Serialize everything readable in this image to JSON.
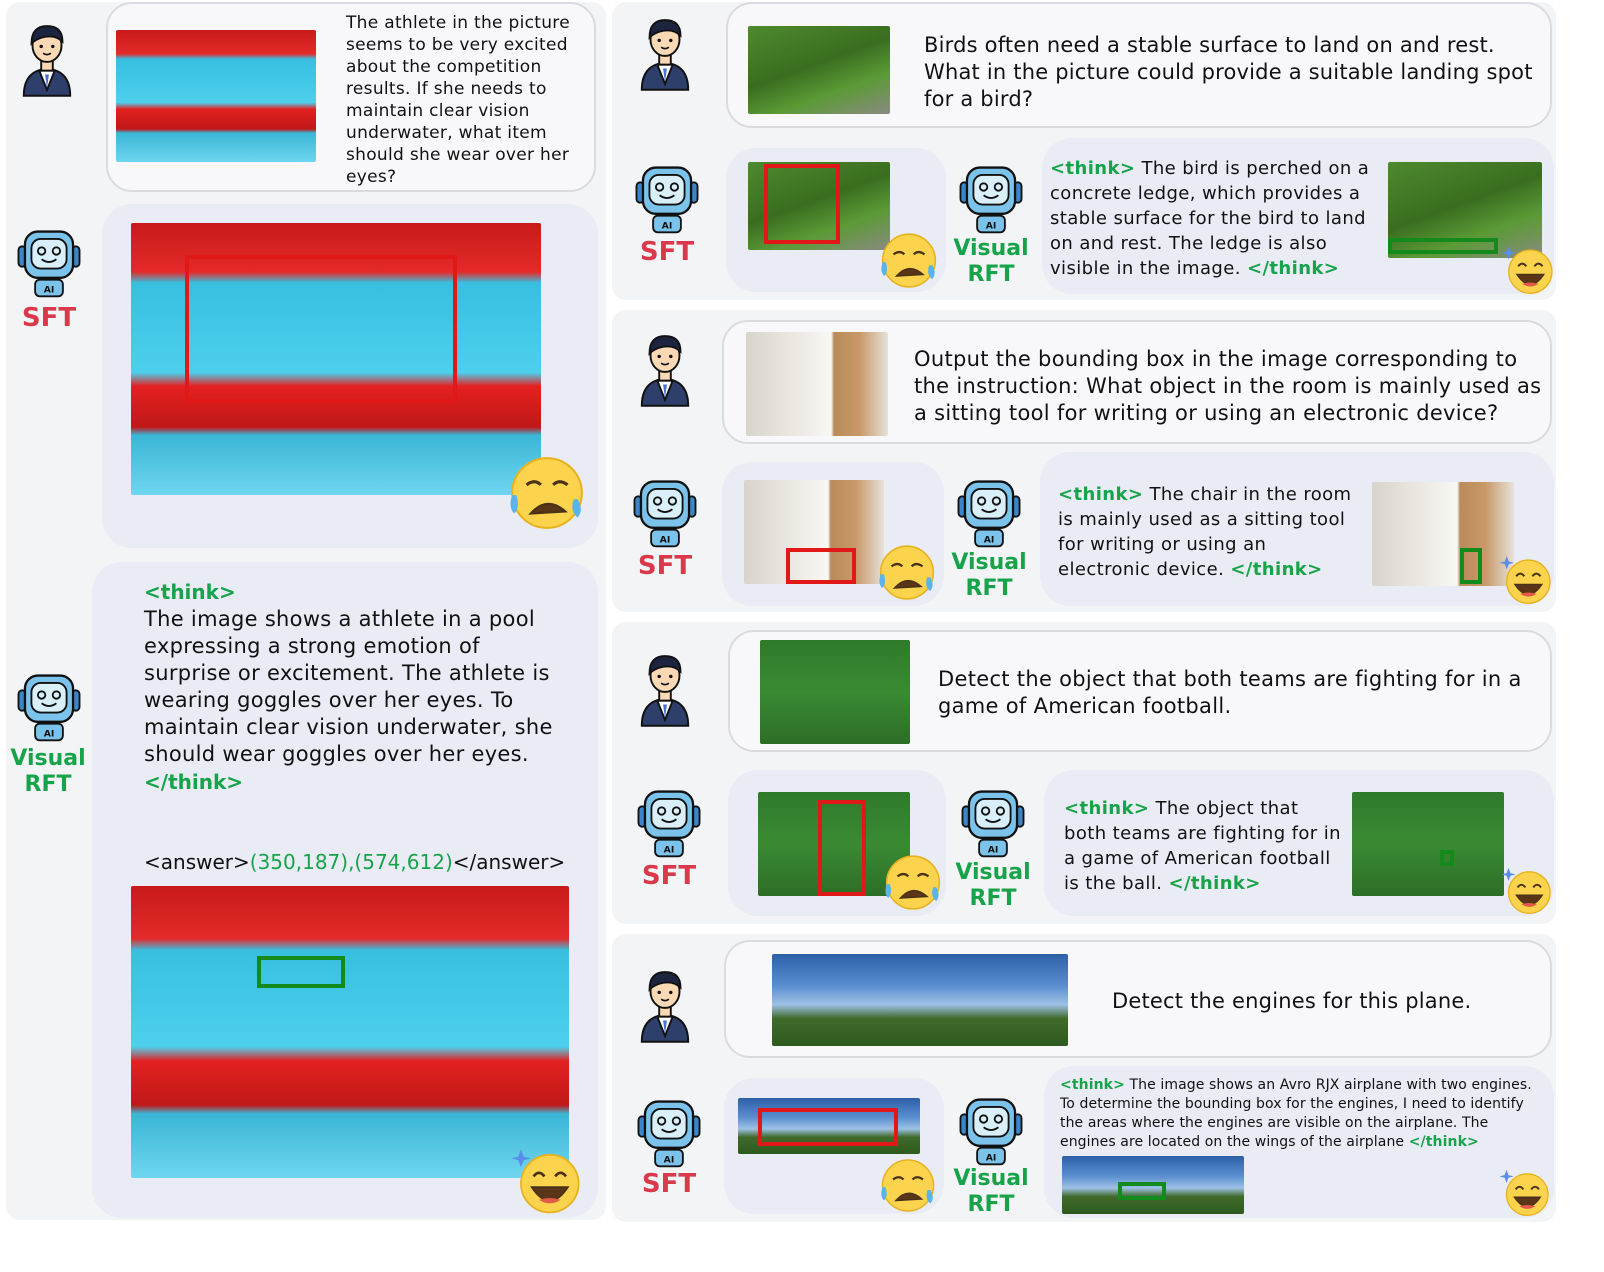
{
  "left": {
    "question": "The athlete in the picture seems to be very excited about the competition results. If she needs to maintain clear vision underwater, what item should she wear over her eyes?",
    "sft_label": "SFT",
    "rft_label_1": "Visual",
    "rft_label_2": "RFT",
    "think_open": "<think>",
    "think_body": "The image shows a athlete in a pool expressing a strong emotion of surprise or excitement. The athlete is wearing goggles over her eyes. To maintain clear vision underwater, she should wear goggles over her eyes.",
    "think_close": "</think>",
    "answer_open": "<answer>",
    "answer_values": "(350,187),(574,612)",
    "answer_close": "</answer>"
  },
  "right": [
    {
      "question": "Birds often need a stable surface to land on and rest. What in the picture could provide a suitable landing spot for a bird?",
      "sft_label": "SFT",
      "rft_label_1": "Visual",
      "rft_label_2": "RFT",
      "think_open": "<think>",
      "think_body": "The bird is perched on a concrete ledge, which provides a stable surface for the bird to land on and rest. The ledge is also visible in the image.",
      "think_close": "</think>"
    },
    {
      "question": "Output the bounding box in the image corresponding to the instruction: What object in the room is mainly used as a sitting tool for writing or using an electronic device?",
      "sft_label": "SFT",
      "rft_label_1": "Visual",
      "rft_label_2": "RFT",
      "think_open": "<think>",
      "think_body": "The chair in the room is mainly used as a sitting tool for writing or using an electronic device.",
      "think_close": "</think>"
    },
    {
      "question": "Detect the object that both teams are fighting for in a game of American football.",
      "sft_label": "SFT",
      "rft_label_1": "Visual",
      "rft_label_2": "RFT",
      "think_open": "<think>",
      "think_body": "The object that both teams are fighting for in a game of American football is the ball.",
      "think_close": "</think>"
    },
    {
      "question": "Detect the engines for this plane.",
      "sft_label": "SFT",
      "rft_label_1": "Visual",
      "rft_label_2": "RFT",
      "think_open": "<think>",
      "think_body": "The image shows an Avro RJX airplane with two engines. To determine the bounding box for the engines, I need to identify the areas where the engines are visible on the airplane. The engines are located on the wings of the airplane",
      "think_close": "</think>"
    }
  ],
  "icons": {
    "user": "user-avatar-icon",
    "robot": "robot-avatar-icon",
    "sad": "crying-face-icon",
    "happy": "laughing-face-icon"
  },
  "colors": {
    "sft": "#d9394a",
    "rft": "#17a34a",
    "red_box": "#e01818",
    "green_box": "#138a1b"
  }
}
